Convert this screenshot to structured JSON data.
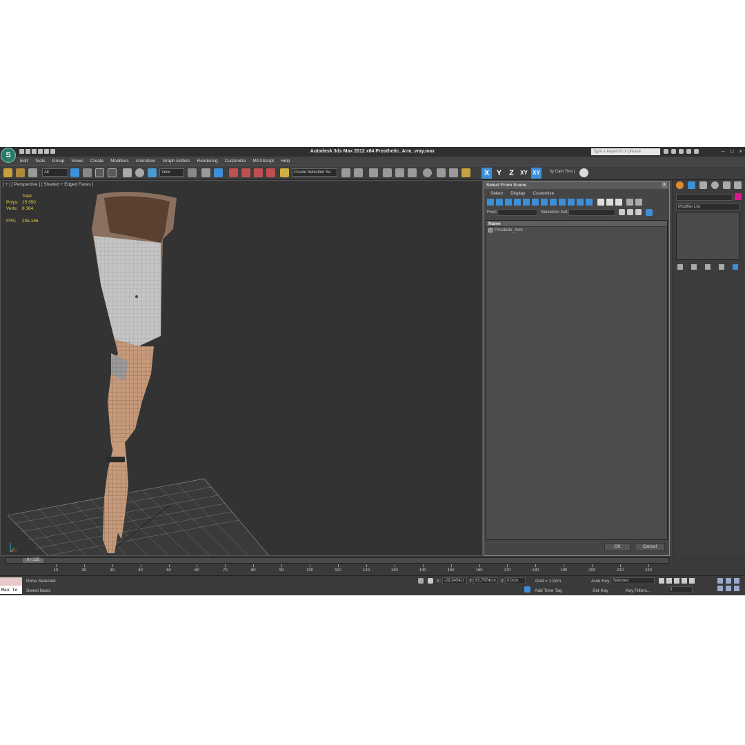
{
  "app": {
    "logo": "S",
    "title": "Autodesk 3ds Max  2012 x64    Prosthetic_Arm_vray.max",
    "search_placeholder": "Type a keyword or phrase"
  },
  "menu": [
    "Edit",
    "Tools",
    "Group",
    "Views",
    "Create",
    "Modifiers",
    "Animation",
    "Graph Editors",
    "Rendering",
    "Customize",
    "MAXScript",
    "Help"
  ],
  "toolbar": {
    "filter": "All",
    "coord": "View",
    "selection_set": "Create Selection Se",
    "axes": [
      "X",
      "Y",
      "Z",
      "XY",
      "XY"
    ],
    "cam_tool": "ity Cam Tool ("
  },
  "viewport": {
    "label": "[ + ] [ Perspective ] [ Shaded + Edged Faces ]",
    "stats": {
      "total_label": "Total",
      "polys_label": "Polys:",
      "polys": "15 950",
      "verts_label": "Verts:",
      "verts": "8 364",
      "fps_label": "FPS:",
      "fps": "235,166"
    }
  },
  "dialog": {
    "title": "Select From Scene",
    "menu": [
      "Select",
      "Display",
      "Customize"
    ],
    "find_label": "Find:",
    "selection_set_label": "Selection Set:",
    "column_name": "Name",
    "objects": [
      "Prostetic_Arm"
    ],
    "ok": "OK",
    "cancel": "Cancel"
  },
  "command_panel": {
    "modifier_list": "Modifier List",
    "accent": "#d81b8a"
  },
  "timeline": {
    "frame": "0 / 225",
    "ticks": [
      "10",
      "20",
      "30",
      "40",
      "50",
      "60",
      "70",
      "80",
      "90",
      "100",
      "110",
      "120",
      "130",
      "140",
      "150",
      "160",
      "170",
      "180",
      "190",
      "200",
      "210",
      "220"
    ]
  },
  "status": {
    "maxscript": "Max to",
    "selection": "None Selected",
    "prompt": "Select faces",
    "x_label": "X:",
    "x": "-29,3454cr",
    "y_label": "Y:",
    "y": "62,7674cm",
    "z_label": "Z:",
    "z": "0,0cm",
    "grid": "Grid = 1,0cm",
    "add_time_tag": "Add Time Tag",
    "auto_key": "Auto Key",
    "selected": "Selected",
    "set_key": "Set Key",
    "key_filters": "Key Filters...",
    "frame_value": "0"
  }
}
